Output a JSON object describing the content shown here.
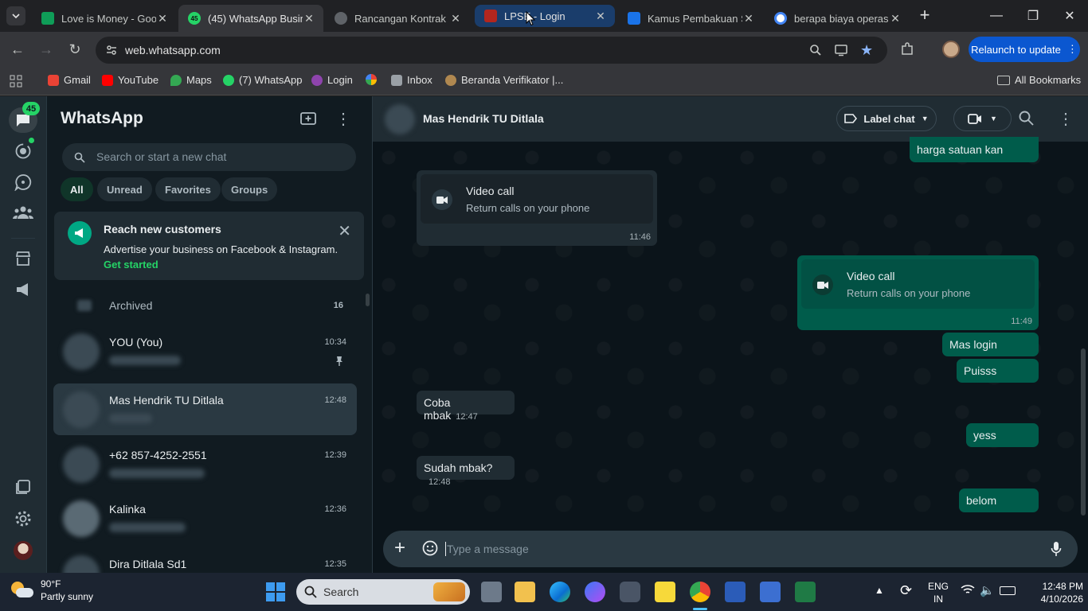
{
  "browser": {
    "tabs": [
      {
        "title": "Love is Money - Goo",
        "favicon_color": "#0f9d58"
      },
      {
        "title": "(45) WhatsApp Busin",
        "favicon_color": "#25d366",
        "favicon_text": "45"
      },
      {
        "title": "Rancangan Kontrak P",
        "favicon_color": "#5f6368"
      },
      {
        "title": "LPSE - Login",
        "favicon_color": "#b3261e"
      },
      {
        "title": "Kamus Pembakuan S",
        "favicon_color": "#1a73e8"
      },
      {
        "title": "berapa biaya operasi",
        "favicon_color": "#4285f4"
      }
    ],
    "url": "web.whatsapp.com",
    "relaunch_label": "Relaunch to update",
    "bookmarks": [
      {
        "label": "Gmail",
        "color": "#ea4335"
      },
      {
        "label": "YouTube",
        "color": "#ff0000"
      },
      {
        "label": "Maps",
        "color": "#34a853"
      },
      {
        "label": "(7) WhatsApp",
        "color": "#25d366"
      },
      {
        "label": "Login",
        "color": "#8e44ad"
      },
      {
        "label": "",
        "color": "#fbbc04"
      },
      {
        "label": "Inbox",
        "color": "#9aa0a6"
      },
      {
        "label": "Beranda Verifikator |...",
        "color": "#b08850"
      }
    ],
    "all_bookmarks_label": "All Bookmarks"
  },
  "whatsapp": {
    "unread_badge": "45",
    "title": "WhatsApp",
    "search_placeholder": "Search or start a new chat",
    "filters": [
      "All",
      "Unread",
      "Favorites",
      "Groups"
    ],
    "promo": {
      "heading": "Reach new customers",
      "body": "Advertise your business on Facebook & Instagram.",
      "link": "Get started"
    },
    "archived": {
      "label": "Archived",
      "count": "16"
    },
    "chats": [
      {
        "name": "YOU (You)",
        "time": "10:34",
        "pinned": true
      },
      {
        "name": "Mas Hendrik TU Ditlala",
        "time": "12:48",
        "selected": true
      },
      {
        "name": "+62 857-4252-2551",
        "time": "12:39"
      },
      {
        "name": "Kalinka",
        "time": "12:36"
      },
      {
        "name": "Dira Ditlala Sd1",
        "time": "12:35"
      }
    ],
    "conversation": {
      "contact": "Mas Hendrik TU Ditlala",
      "label_chat": "Label chat",
      "messages": [
        {
          "dir": "out",
          "text": "harga satuan kan"
        },
        {
          "dir": "in",
          "type": "call",
          "title": "Video call",
          "subtitle": "Return calls on your phone",
          "time": "11:46"
        },
        {
          "dir": "out",
          "type": "call",
          "title": "Video call",
          "subtitle": "Return calls on your phone",
          "time": "11:49"
        },
        {
          "dir": "out",
          "text": "Mas login"
        },
        {
          "dir": "out",
          "text": "Puisss"
        },
        {
          "dir": "in",
          "text": "Coba mbak",
          "time": "12:47"
        },
        {
          "dir": "out",
          "text": "yess"
        },
        {
          "dir": "in",
          "text": "Sudah mbak?",
          "time": "12:48"
        },
        {
          "dir": "out",
          "text": "belom"
        }
      ],
      "composer_placeholder": "Type a message"
    }
  },
  "taskbar": {
    "weather_temp": "90°F",
    "weather_desc": "Partly sunny",
    "search_label": "Search",
    "language": "ENG",
    "region": "IN",
    "time": "12:48 PM",
    "date": "4/10/2026"
  }
}
